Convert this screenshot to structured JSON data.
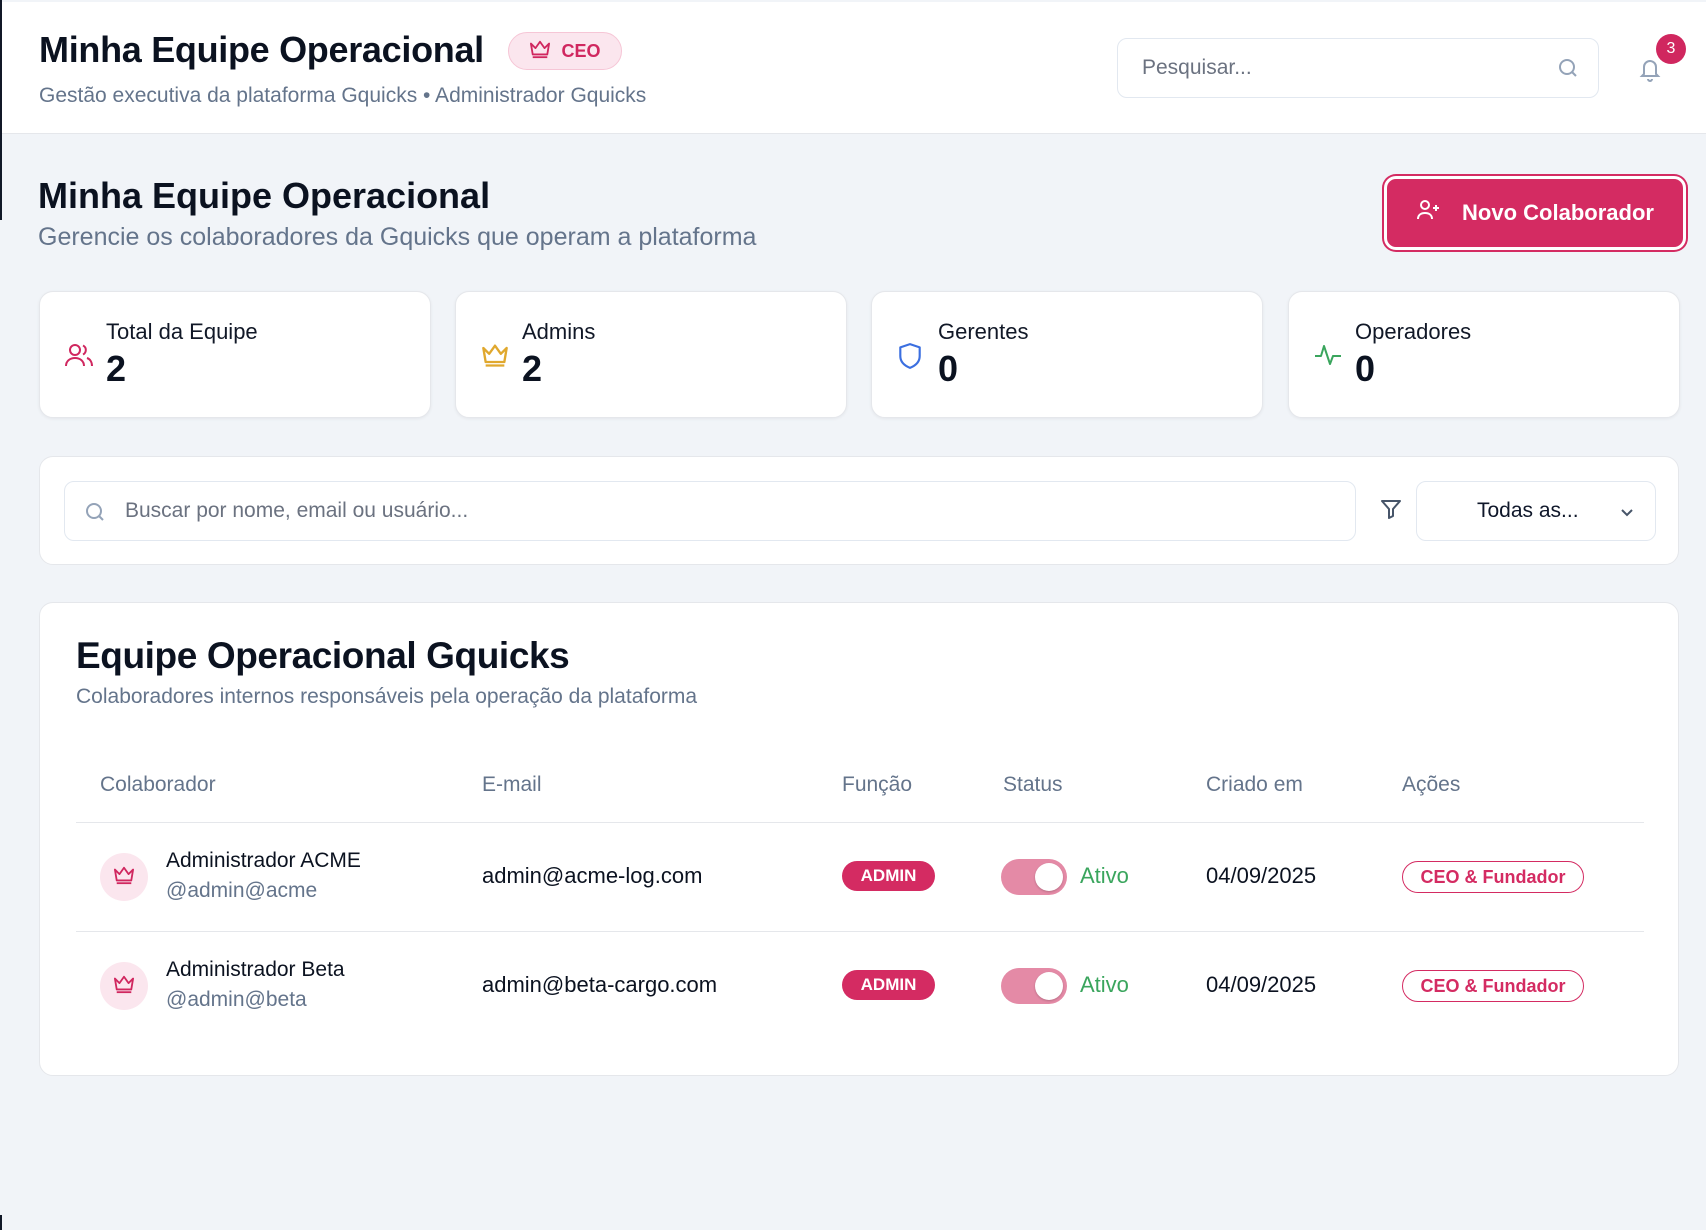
{
  "header": {
    "title": "Minha Equipe Operacional",
    "badge": "CEO",
    "subtitle": "Gestão executiva da plataforma Gquicks • Administrador Gquicks",
    "search_placeholder": "Pesquisar...",
    "notification_count": "3"
  },
  "page": {
    "title": "Minha Equipe Operacional",
    "subtitle": "Gerencie os colaboradores da Gquicks que operam a plataforma",
    "new_button": "Novo Colaborador"
  },
  "stats": [
    {
      "label": "Total da Equipe",
      "value": "2",
      "icon": "users-icon",
      "color": "#d0275f"
    },
    {
      "label": "Admins",
      "value": "2",
      "icon": "crown-icon",
      "color": "#e0a82e"
    },
    {
      "label": "Gerentes",
      "value": "0",
      "icon": "shield-icon",
      "color": "#3b6fe0"
    },
    {
      "label": "Operadores",
      "value": "0",
      "icon": "activity-icon",
      "color": "#3aa55d"
    }
  ],
  "filters": {
    "search_placeholder": "Buscar por nome, email ou usuário...",
    "select_value": "Todas as..."
  },
  "table": {
    "title": "Equipe Operacional Gquicks",
    "subtitle": "Colaboradores internos responsáveis pela operação da plataforma",
    "columns": [
      "Colaborador",
      "E-mail",
      "Função",
      "Status",
      "Criado em",
      "Ações"
    ],
    "rows": [
      {
        "name": "Administrador ACME",
        "handle": "@admin@acme",
        "email": "admin@acme-log.com",
        "role": "ADMIN",
        "status": "Ativo",
        "created": "04/09/2025",
        "action": "CEO & Fundador"
      },
      {
        "name": "Administrador Beta",
        "handle": "@admin@beta",
        "email": "admin@beta-cargo.com",
        "role": "ADMIN",
        "status": "Ativo",
        "created": "04/09/2025",
        "action": "CEO & Fundador"
      }
    ]
  },
  "colors": {
    "accent": "#d42b62",
    "active": "#3aa55d",
    "muted": "#64748b"
  }
}
